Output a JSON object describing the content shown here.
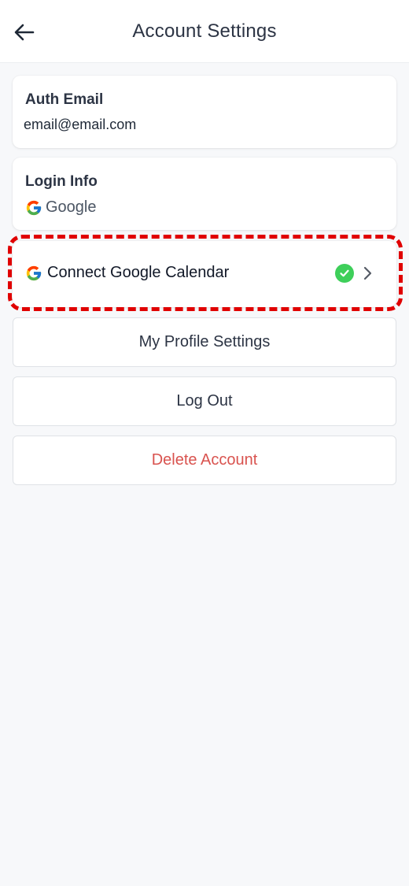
{
  "header": {
    "title": "Account Settings",
    "back_icon": "arrow-left-icon"
  },
  "auth_email": {
    "label": "Auth Email",
    "value": "email@email.com"
  },
  "login_info": {
    "label": "Login Info",
    "provider": "Google",
    "provider_icon": "google-icon"
  },
  "calendar": {
    "label": "Connect Google Calendar",
    "icon": "google-icon",
    "status_icon": "check-circle-icon",
    "status_color": "#3ecf5a",
    "connected": true,
    "chevron_icon": "chevron-right-icon"
  },
  "actions": {
    "profile": "My Profile Settings",
    "logout": "Log Out",
    "delete": "Delete Account"
  },
  "colors": {
    "danger": "#d9534f",
    "highlight": "#e00000",
    "background": "#f7f8fa"
  }
}
